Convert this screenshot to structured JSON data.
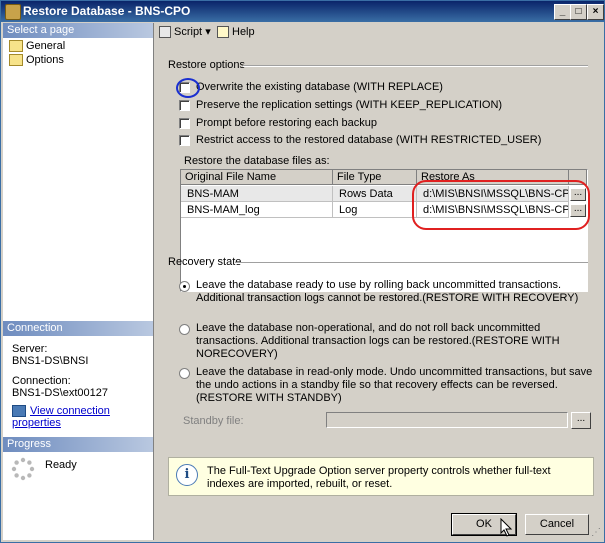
{
  "window": {
    "title": "Restore Database - BNS-CPO"
  },
  "left_pane": {
    "select_page_header": "Select a page",
    "pages": [
      "General",
      "Options"
    ],
    "connection_header": "Connection",
    "server_label": "Server:",
    "server_value": "BNS1-DS\\BNSI",
    "connection_label": "Connection:",
    "connection_value": "BNS1-DS\\ext00127",
    "view_connection_link": "View connection properties",
    "progress_header": "Progress",
    "progress_status": "Ready"
  },
  "toolbar": {
    "script_label": "Script",
    "help_label": "Help"
  },
  "restore_options": {
    "header": "Restore options",
    "checkboxes": [
      "Overwrite the existing database (WITH REPLACE)",
      "Preserve the replication settings (WITH KEEP_REPLICATION)",
      "Prompt before restoring each backup",
      "Restrict access to the restored database (WITH RESTRICTED_USER)"
    ],
    "files_label": "Restore the database files as:"
  },
  "files_grid": {
    "columns": [
      "Original File Name",
      "File Type",
      "Restore As"
    ],
    "rows": [
      {
        "name": "BNS-MAM",
        "type": "Rows Data",
        "restore_as": "d:\\MIS\\BNSI\\MSSQL\\BNS-CP..."
      },
      {
        "name": "BNS-MAM_log",
        "type": "Log",
        "restore_as": "d:\\MIS\\BNSI\\MSSQL\\BNS-CP..."
      }
    ],
    "browse_label": "..."
  },
  "recovery_state": {
    "header": "Recovery state",
    "options": [
      "Leave the database ready to use by rolling back uncommitted transactions. Additional transaction logs cannot be restored.(RESTORE WITH RECOVERY)",
      "Leave the database non-operational, and do not roll back uncommitted transactions. Additional transaction logs can be restored.(RESTORE WITH NORECOVERY)",
      "Leave the database in read-only mode. Undo uncommitted transactions, but save the undo actions in a standby file so that recovery effects can be reversed.(RESTORE WITH STANDBY)"
    ],
    "standby_label": "Standby file:",
    "standby_browse": "..."
  },
  "info": {
    "text": "The Full-Text Upgrade Option server property controls whether full-text indexes are imported, rebuilt, or reset."
  },
  "buttons": {
    "ok": "OK",
    "cancel": "Cancel"
  },
  "colors": {
    "annotation_red": "#e02020",
    "annotation_blue": "#1a2fd0"
  }
}
